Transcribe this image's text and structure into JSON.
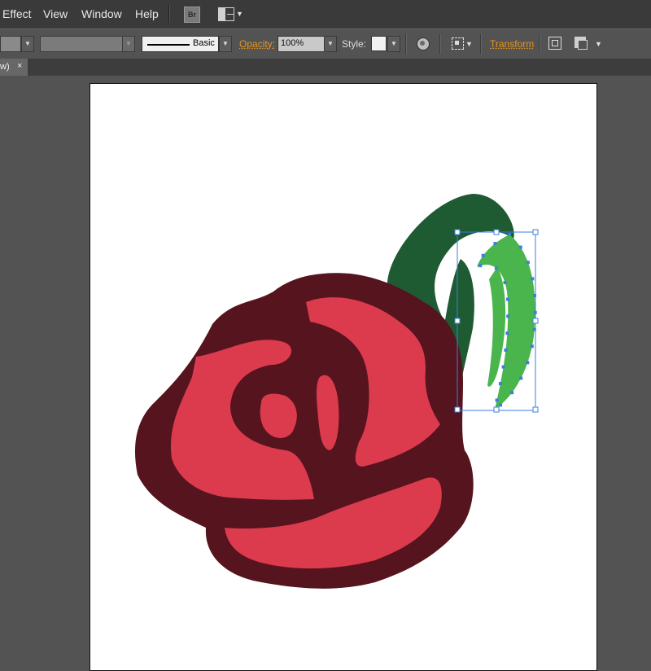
{
  "menu": {
    "items": [
      "Effect",
      "View",
      "Window",
      "Help"
    ],
    "bridge_label": "Br"
  },
  "control_bar": {
    "stroke_profile": "Basic",
    "opacity_label": "Opacity:",
    "opacity_value": "100%",
    "style_label": "Style:",
    "transform_label": "Transform"
  },
  "tab": {
    "label": "w)",
    "close": "×"
  },
  "colors": {
    "rose_outline": "#55141e",
    "rose_petal": "#dc3a4d",
    "leaf_dark": "#1e5b33",
    "leaf_selected": "#4ab54c",
    "selection": "#3b7fe0"
  }
}
